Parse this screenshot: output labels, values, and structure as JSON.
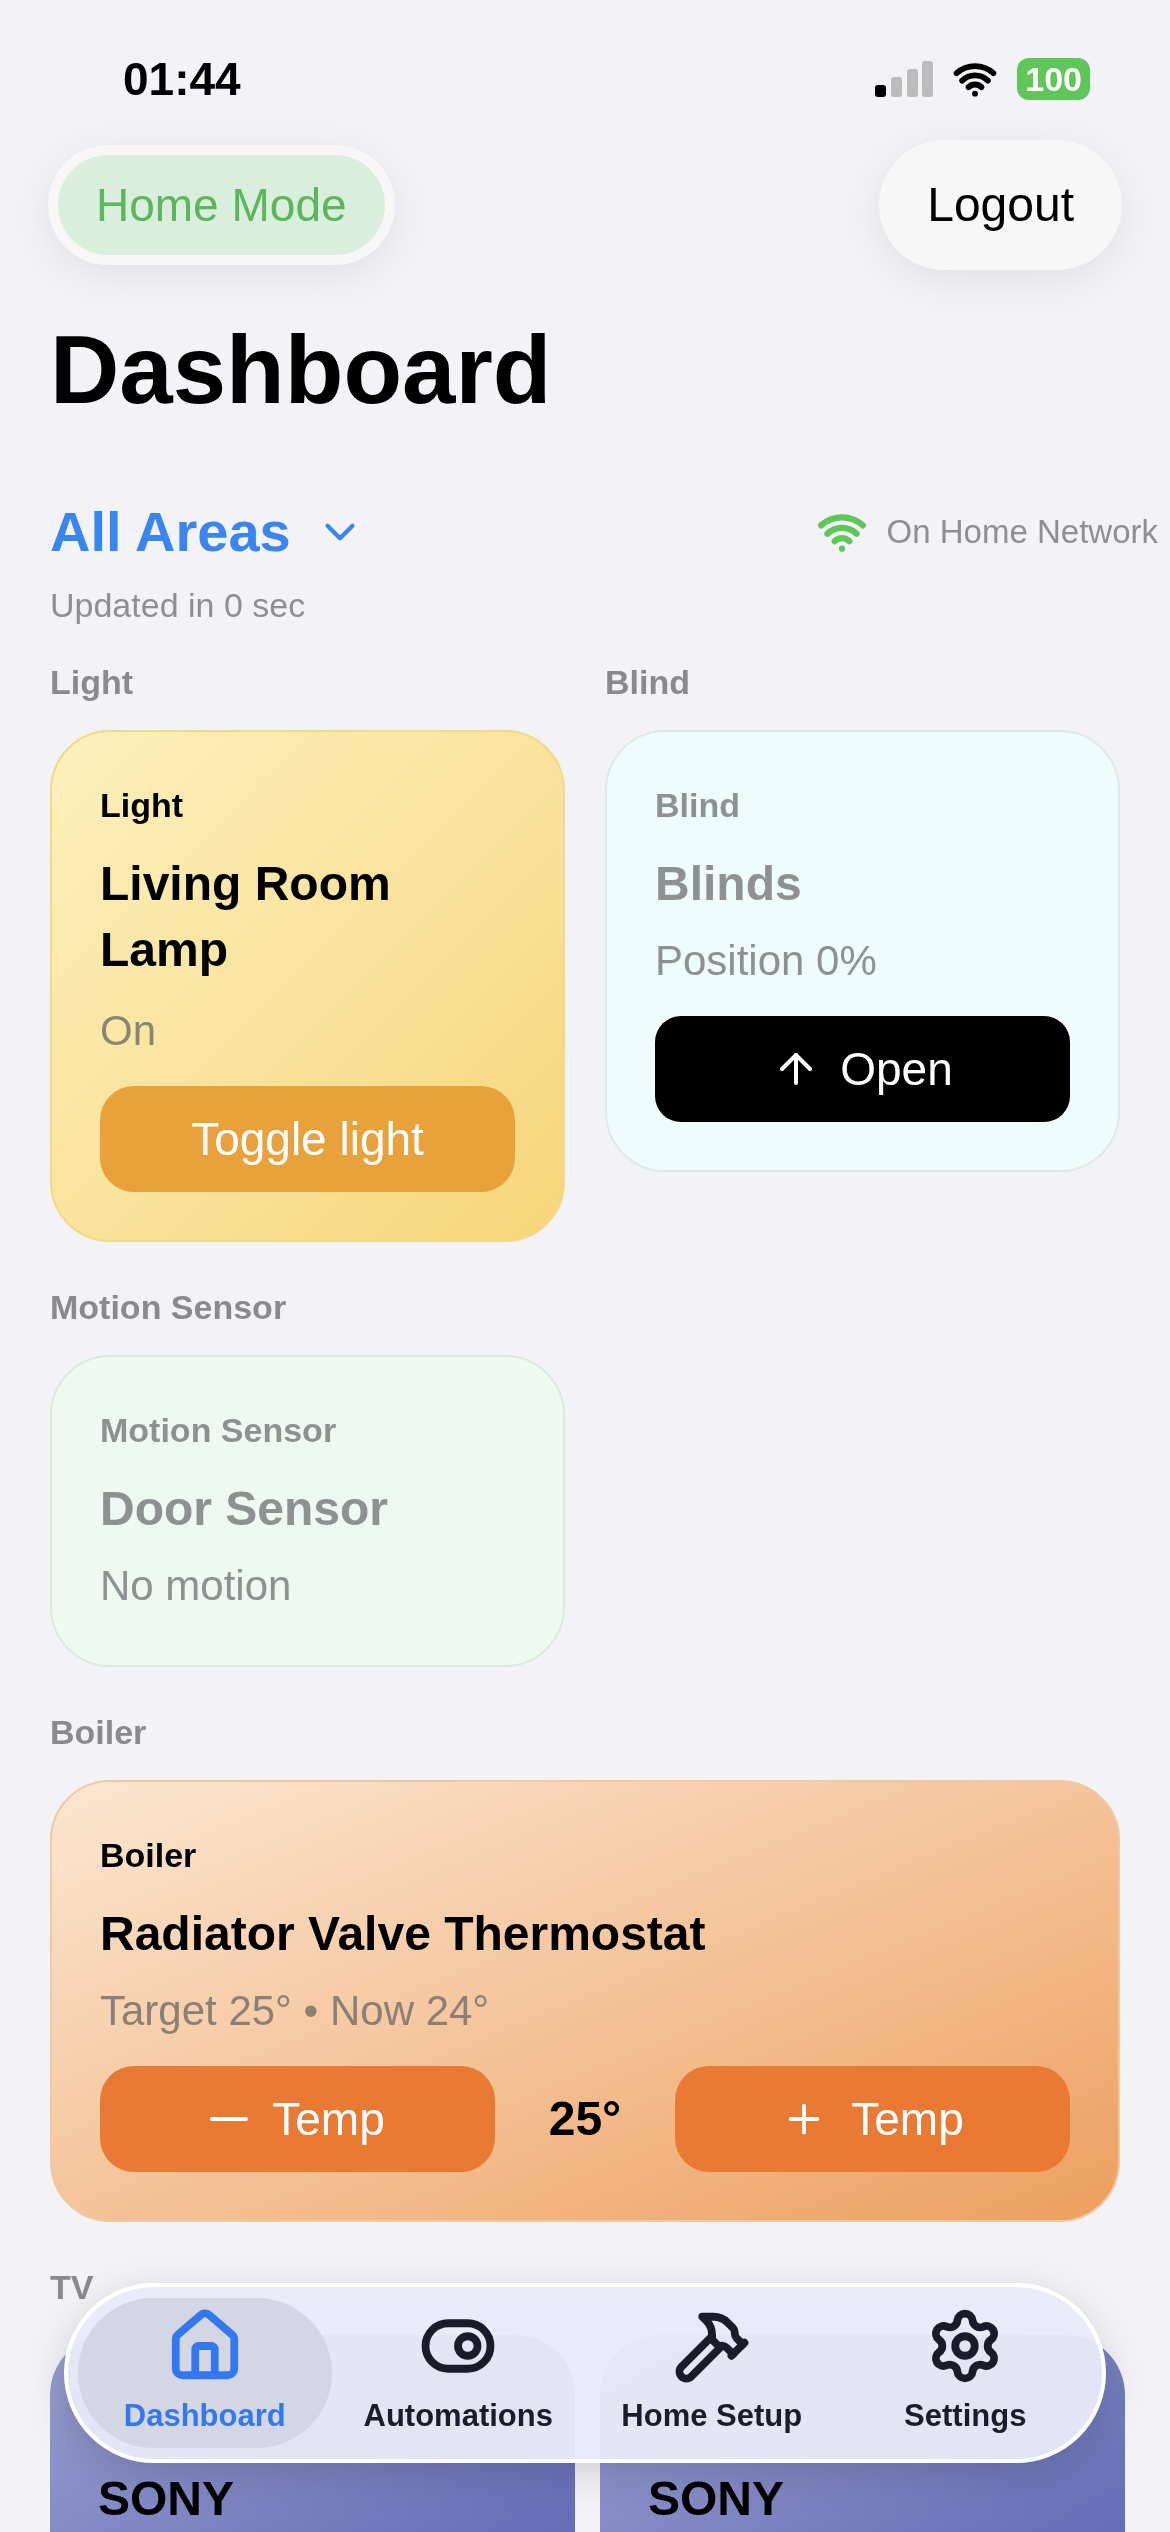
{
  "status_bar": {
    "time": "01:44",
    "battery": "100"
  },
  "header": {
    "mode": "Home Mode",
    "logout": "Logout",
    "title": "Dashboard"
  },
  "area": {
    "selector": "All Areas",
    "updated": "Updated in 0 sec",
    "network": "On Home Network"
  },
  "sections": [
    {
      "label": "Light",
      "devices": [
        {
          "kind": "light",
          "type": "Light",
          "name": "Living Room Lamp",
          "status": "On",
          "action": "Toggle light"
        }
      ]
    },
    {
      "label": "Blind",
      "devices": [
        {
          "kind": "blind",
          "type": "Blind",
          "name": "Blinds",
          "status": "Position 0%",
          "action": "Open"
        }
      ]
    },
    {
      "label": "Motion Sensor",
      "devices": [
        {
          "kind": "motion",
          "type": "Motion Sensor",
          "name": "Door Sensor",
          "status": "No motion"
        }
      ]
    },
    {
      "label": "Boiler",
      "devices": [
        {
          "kind": "boiler",
          "type": "Boiler",
          "name": "Radiator Valve Thermostat",
          "status": "Target 25° • Now 24°",
          "decrease": "Temp",
          "setpoint": "25°",
          "increase": "Temp"
        }
      ]
    },
    {
      "label": "TV",
      "devices": [
        {
          "kind": "tv",
          "name": "SONY"
        },
        {
          "kind": "tv",
          "name": "SONY"
        }
      ]
    }
  ],
  "tabs": [
    {
      "label": "Dashboard",
      "selected": true
    },
    {
      "label": "Automations",
      "selected": false
    },
    {
      "label": "Home Setup",
      "selected": false
    },
    {
      "label": "Settings",
      "selected": false
    }
  ]
}
